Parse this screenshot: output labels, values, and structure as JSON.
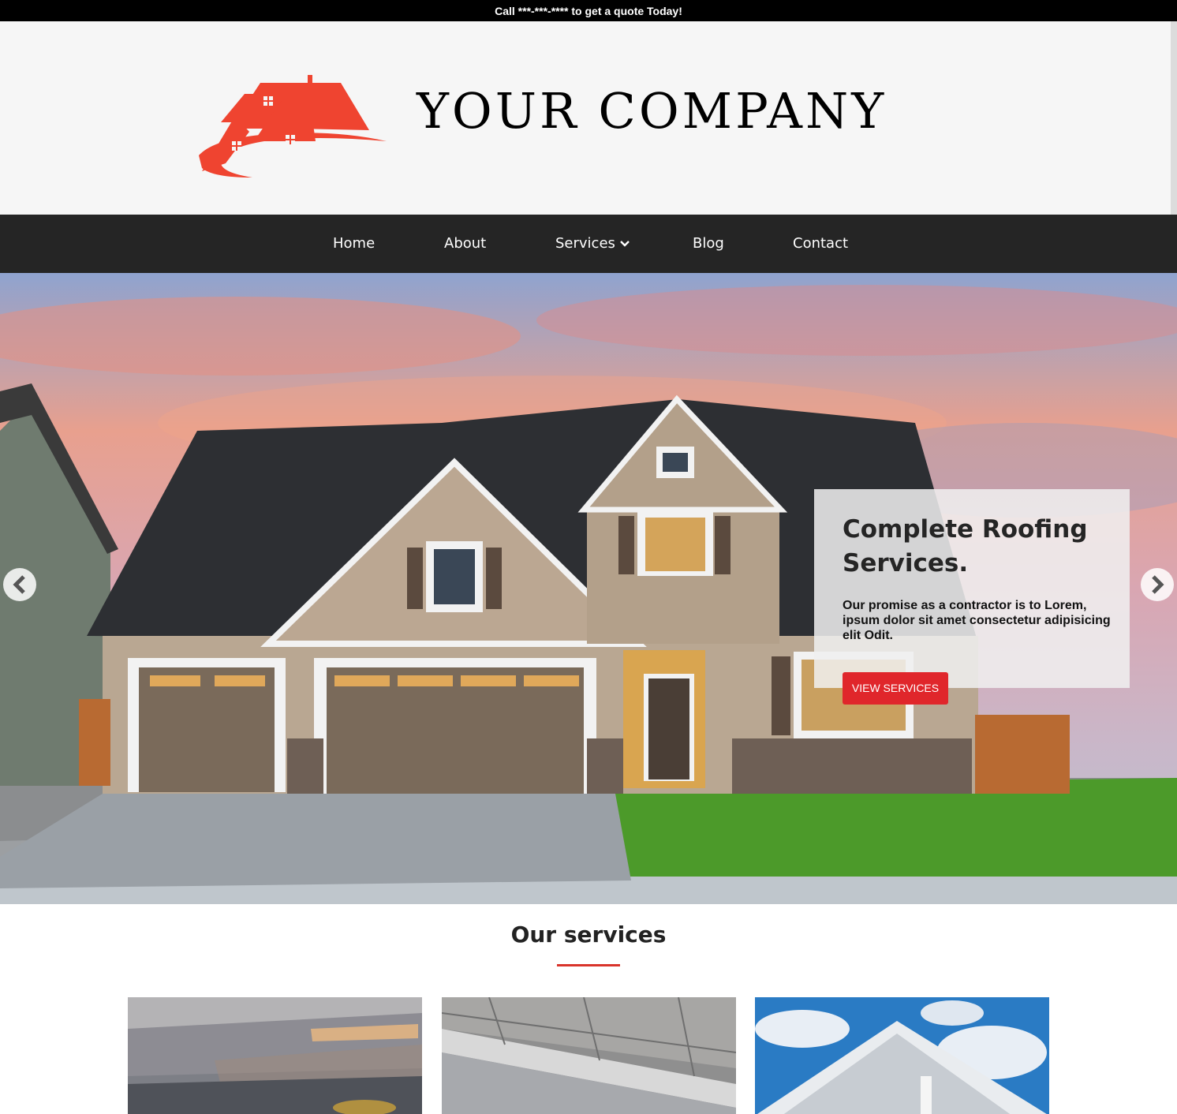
{
  "topbar": {
    "text": "Call ***-***-**** to get a quote Today!"
  },
  "header": {
    "brand_name": "YOUR COMPANY",
    "logo_icon": "house-roof-logo"
  },
  "nav": {
    "items": [
      {
        "label": "Home"
      },
      {
        "label": "About"
      },
      {
        "label": "Services",
        "has_dropdown": true
      },
      {
        "label": "Blog"
      },
      {
        "label": "Contact"
      }
    ]
  },
  "hero": {
    "title": "Complete Roofing Services.",
    "text": "Our promise as a contractor is to Lorem, ipsum dolor sit amet consectetur adipisicing elit Odit.",
    "button_label": "VIEW SERVICES",
    "prev_icon": "chevron-left-icon",
    "next_icon": "chevron-right-icon"
  },
  "services": {
    "title": "Our services",
    "cards": [
      {
        "image": "roof-shingles-installation-photo"
      },
      {
        "image": "roof-gutter-photo"
      },
      {
        "image": "roof-fascia-sky-photo"
      }
    ]
  },
  "colors": {
    "accent": "#e0262b",
    "nav_bg": "#252525",
    "header_bg": "#f6f6f6"
  }
}
